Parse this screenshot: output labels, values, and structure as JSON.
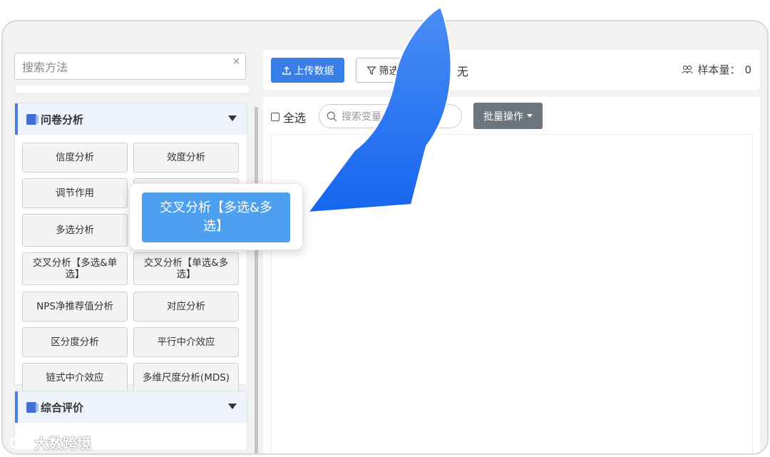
{
  "sidebar": {
    "search": {
      "placeholder": "搜索方法",
      "clear": "×"
    },
    "sections": [
      {
        "title": "问卷分析",
        "items": [
          "信度分析",
          "效度分析",
          "调节作用",
          "",
          "多选分析",
          "",
          "交叉分析【多选&单选】",
          "交叉分析【单选&多选】",
          "NPS净推荐值分析",
          "对应分析",
          "区分度分析",
          "平行中介效应",
          "链式中介效应",
          "多维尺度分析(MDS)"
        ]
      },
      {
        "title": "综合评价"
      }
    ]
  },
  "popup": {
    "label": "交叉分析【多选&多选】"
  },
  "toolbar": {
    "upload_label": "上传数据",
    "filter_label": "筛选样本",
    "none_label": "无",
    "sample_label": "样本量：",
    "sample_value": "0"
  },
  "panel": {
    "select_all": "全选",
    "search_placeholder": "搜索变量...",
    "batch_label": "批量操作"
  },
  "watermark": "大数跨境",
  "colors": {
    "primary": "#3a7fe8",
    "popup": "#4d9ff0",
    "arrow": "#1e6ff0",
    "batch": "#6c757d"
  }
}
